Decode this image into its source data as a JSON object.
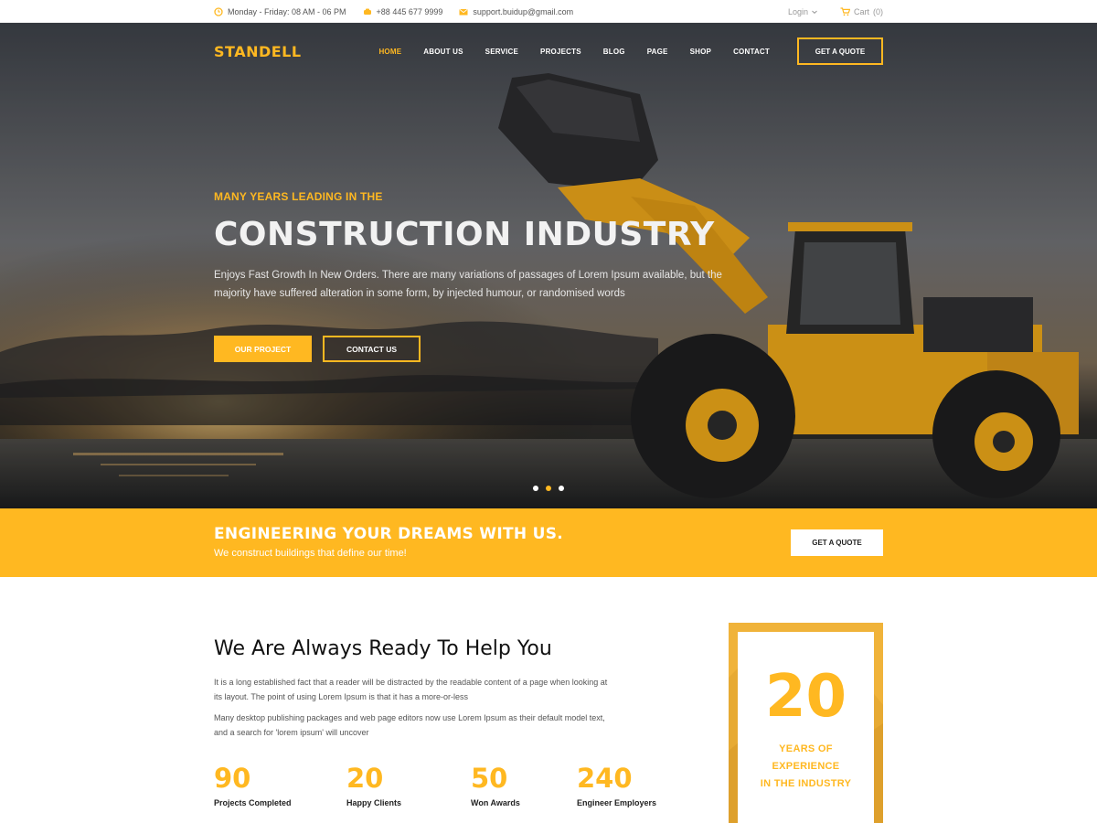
{
  "topbar": {
    "hours": "Monday - Friday: 08 AM - 06 PM",
    "phone": "+88 445 677 9999",
    "email": "support.buidup@gmail.com",
    "login": "Login",
    "cart": "Cart",
    "cart_count": "(0)",
    "icons": [
      "clock-icon",
      "phone-icon",
      "envelope-icon",
      "chevron-down-icon",
      "cart-icon"
    ]
  },
  "nav": {
    "logo": "STANDELL",
    "items": [
      "HOME",
      "ABOUT US",
      "SERVICE",
      "PROJECTS",
      "BLOG",
      "PAGE",
      "SHOP",
      "CONTACT"
    ],
    "active_index": 0,
    "quote_button": "GET A QUOTE"
  },
  "hero": {
    "kicker": "MANY YEARS LEADING IN THE",
    "title": "CONSTRUCTION INDUSTRY",
    "description": "Enjoys Fast Growth In New Orders. There are many variations of passages of Lorem Ipsum available, but the majority have suffered alteration in some form, by injected humour, or randomised words",
    "primary_button": "OUR PROJECT",
    "secondary_button": "CONTACT US",
    "slides": 3,
    "active_slide": 2
  },
  "band": {
    "title": "ENGINEERING YOUR DREAMS WITH US.",
    "subtitle": "We construct buildings that define our time!",
    "button": "GET A QUOTE"
  },
  "about": {
    "title": "We Are Always Ready To Help You",
    "paragraph1": "It is a long established fact that a reader will be distracted by the readable content of a page when looking at its layout. The point of using Lorem Ipsum is that it has a more-or-less",
    "paragraph2": "Many desktop publishing packages and web page editors now use Lorem Ipsum as their default model text, and a search for 'lorem ipsum' will uncover",
    "stats": [
      {
        "number": "90",
        "label": "Projects Completed"
      },
      {
        "number": "20",
        "label": "Happy Clients"
      },
      {
        "number": "50",
        "label": "Won Awards"
      },
      {
        "number": "240",
        "label": "Engineer Employers"
      }
    ],
    "experience": {
      "number": "20",
      "line1": "YEARS OF",
      "line2": "EXPERIENCE",
      "line3": "IN THE INDUSTRY"
    }
  },
  "colors": {
    "accent": "#ffb821",
    "dark": "#222222"
  }
}
